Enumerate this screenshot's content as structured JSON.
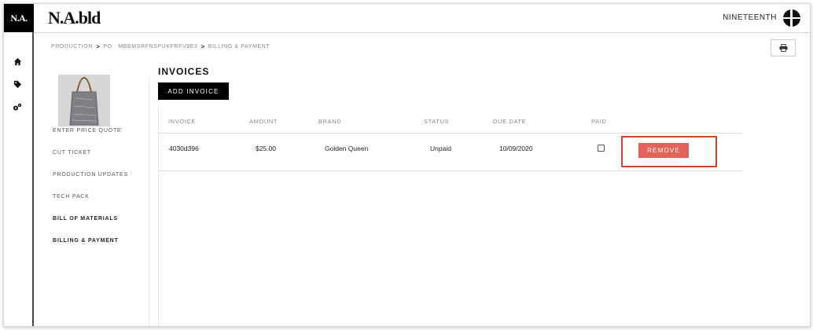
{
  "app": {
    "logo_short": "N.A.",
    "brand": "N.A.bld",
    "account_name": "NINETEENTH"
  },
  "sidebar": {
    "icons": [
      "home-icon",
      "tags-icon",
      "cogs-icon"
    ]
  },
  "breadcrumb": {
    "items": [
      "PRODUCTION",
      "PO : MBBMSRFNSPUKFRFV9E3",
      "BILLING & PAYMENT"
    ],
    "separator": ">"
  },
  "toolbar": {
    "print_icon": "print-icon"
  },
  "subnav": {
    "items": [
      {
        "label": "ENTER PRICE QUOTE"
      },
      {
        "label": "CUT TICKET"
      },
      {
        "label": "PRODUCTION UPDATES"
      },
      {
        "label": "TECH PACK"
      },
      {
        "label": "BILL OF MATERIALS"
      },
      {
        "label": "BILLING & PAYMENT"
      }
    ]
  },
  "invoices": {
    "title": "INVOICES",
    "add_label": "ADD INVOICE",
    "columns": [
      "INVOICE",
      "AMOUNT",
      "BRAND",
      "STATUS",
      "DUE DATE",
      "PAID"
    ],
    "rows": [
      {
        "invoice": "4030d396",
        "amount": "$25.00",
        "brand": "Golden Queen",
        "status": "Unpaid",
        "due_date": "10/09/2020",
        "paid": false,
        "remove_label": "REMOVE"
      }
    ]
  },
  "colors": {
    "remove_button": "#e0645a",
    "highlight_outline": "#c74433",
    "primary_dark": "#000000"
  }
}
